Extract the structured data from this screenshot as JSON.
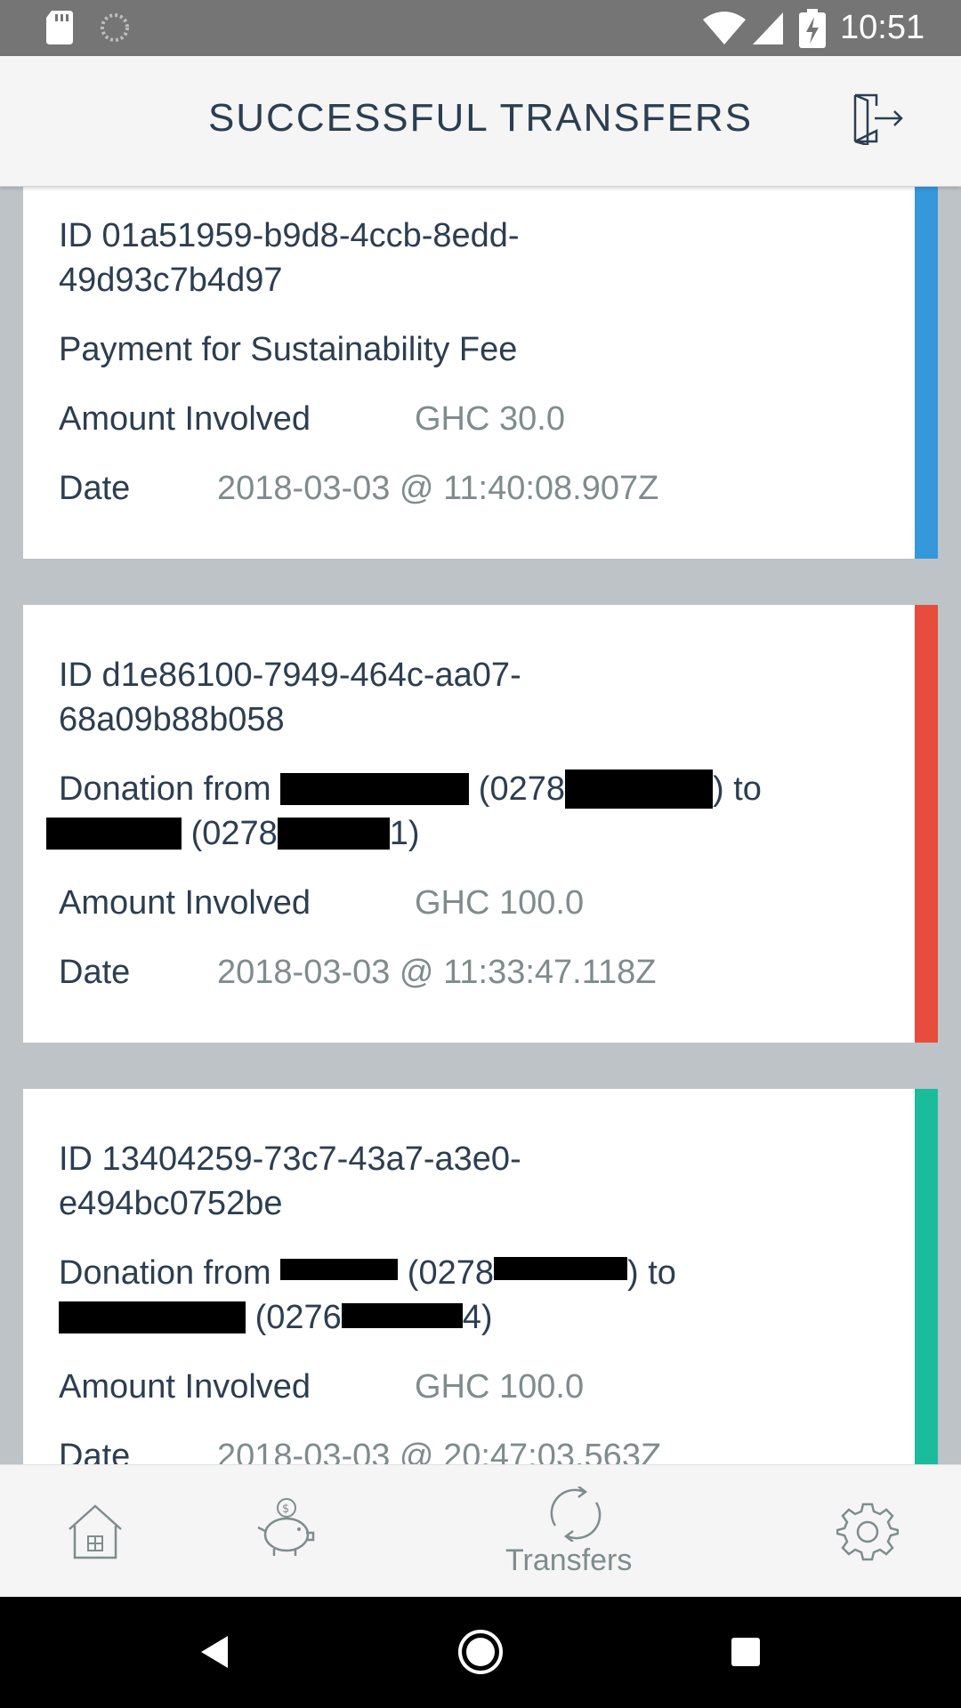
{
  "status_bar": {
    "time": "10:51",
    "icons": [
      "sd-card-icon",
      "sync-icon",
      "wifi-icon",
      "signal-icon",
      "battery-charging-icon"
    ]
  },
  "header": {
    "title": "SUCCESSFUL TRANSFERS",
    "logout_icon": "logout-icon"
  },
  "transfers": [
    {
      "id_line1": "ID 01a51959-b9d8-4ccb-8edd-",
      "id_line2": "49d93c7b4d97",
      "description": "Payment for Sustainability Fee",
      "amount_label": "Amount Involved",
      "amount": "GHC 30.0",
      "date_label": "Date",
      "date": "2018-03-03 @ 11:40:08.907Z",
      "stripe_color": "#3498db"
    },
    {
      "id_line1": "ID d1e86100-7949-464c-aa07-",
      "id_line2": "68a09b88b058",
      "desc_prefix": "Donation from",
      "desc_mid1": "(0278",
      "desc_mid2": ") to",
      "desc_l2_mid": "(0278",
      "desc_l2_end": "1)",
      "amount_label": "Amount Involved",
      "amount": "GHC 100.0",
      "date_label": "Date",
      "date": "2018-03-03 @ 11:33:47.118Z",
      "stripe_color": "#e74c3c"
    },
    {
      "id_line1": "ID 13404259-73c7-43a7-a3e0-",
      "id_line2": "e494bc0752be",
      "desc_prefix": "Donation from",
      "desc_mid1": "(0278",
      "desc_mid2": ") to",
      "desc_l2_mid": "(0276",
      "desc_l2_end": "4)",
      "amount_label": "Amount Involved",
      "amount": "GHC 100.0",
      "date_label": "Date",
      "date": "2018-03-03 @ 20:47:03.563Z",
      "stripe_color": "#1abc9c"
    }
  ],
  "bottom_nav": {
    "items": [
      {
        "icon": "home-icon"
      },
      {
        "icon": "piggy-bank-icon"
      },
      {
        "icon": "transfers-icon",
        "label": "Transfers",
        "active": true
      },
      {
        "icon": "settings-icon"
      }
    ]
  },
  "system_nav": {
    "icons": [
      "back-icon",
      "home-circle-icon",
      "recents-icon"
    ]
  }
}
